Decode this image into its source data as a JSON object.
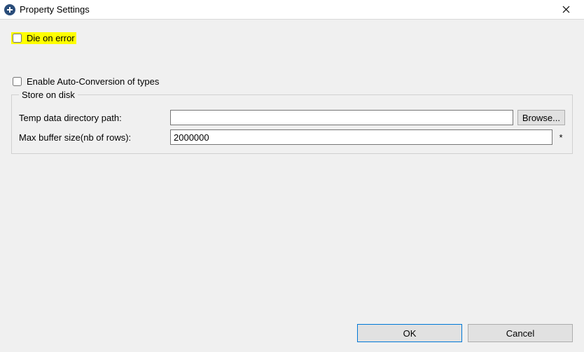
{
  "window": {
    "title": "Property Settings"
  },
  "checks": {
    "die_on_error_label": "Die on error",
    "die_on_error_checked": false,
    "auto_convert_label": "Enable Auto-Conversion of types",
    "auto_convert_checked": false
  },
  "group": {
    "legend": "Store on disk",
    "temp_path_label": "Temp data directory path:",
    "temp_path_value": "",
    "browse_label": "Browse...",
    "max_buffer_label": "Max buffer size(nb of rows):",
    "max_buffer_value": "2000000",
    "required_mark": "*"
  },
  "buttons": {
    "ok": "OK",
    "cancel": "Cancel"
  }
}
